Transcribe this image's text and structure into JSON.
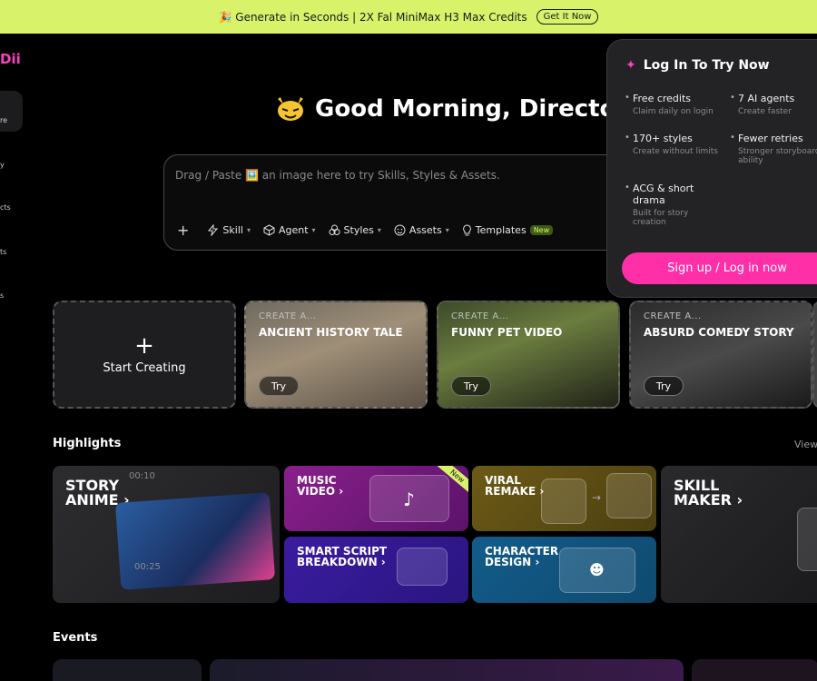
{
  "banner": {
    "text": "🎉 Generate in Seconds | 2X Fal MiniMax H3 Max Credits",
    "button": "Get It Now"
  },
  "sidebar": {
    "logo": "Dii",
    "items": [
      "re",
      "y",
      "cts",
      "ts",
      "s"
    ]
  },
  "greeting": "Good Morning, Director",
  "prompt": {
    "placeholder": "Drag / Paste 🖼️ an image here to try Skills, Styles & Assets.",
    "tools": {
      "skill": "Skill",
      "agent": "Agent",
      "styles": "Styles",
      "assets": "Assets",
      "templates": "Templates",
      "templates_badge": "New"
    }
  },
  "login": {
    "title": "Log In To Try Now",
    "features": [
      {
        "title": "Free credits",
        "sub": "Claim daily on login"
      },
      {
        "title": "7 AI agents",
        "sub": "Create faster"
      },
      {
        "title": "170+ styles",
        "sub": "Create without limits"
      },
      {
        "title": "Fewer retries",
        "sub": "Stronger storyboard ability"
      },
      {
        "title": "ACG & short drama",
        "sub": "Built for story creation"
      }
    ],
    "button": "Sign up / Log in now"
  },
  "create": {
    "start": "Start Creating",
    "prefix": "CREATE A...",
    "try": "Try",
    "templates": [
      "ANCIENT HISTORY TALE",
      "FUNNY PET VIDEO",
      "ABSURD COMEDY STORY"
    ]
  },
  "highlights": {
    "title": "Highlights",
    "view": "View",
    "story": "STORY\nANIME ›",
    "music": "MUSIC\nVIDEO ›",
    "music_badge": "New",
    "viral": "VIRAL\nREMAKE ›",
    "skill": "SKILL\nMAKER ›",
    "script": "SMART SCRIPT\nBREAKDOWN ›",
    "character": "CHARACTER\nDESIGN ›",
    "timer_top": "00:10",
    "timer_bottom": "00:25"
  },
  "events": {
    "title": "Events"
  }
}
